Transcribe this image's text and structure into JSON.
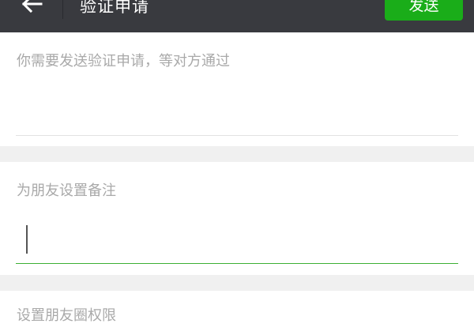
{
  "header": {
    "title": "验证申请",
    "send_label": "发送",
    "back_icon": "arrow-left-icon",
    "background_color": "#393a3f",
    "accent_color": "#1aad19"
  },
  "verify_request": {
    "placeholder": "你需要发送验证申请，等对方通过",
    "value": ""
  },
  "remark": {
    "label": "为朋友设置备注",
    "value": ""
  },
  "moments_permission": {
    "label": "设置朋友圈权限"
  }
}
